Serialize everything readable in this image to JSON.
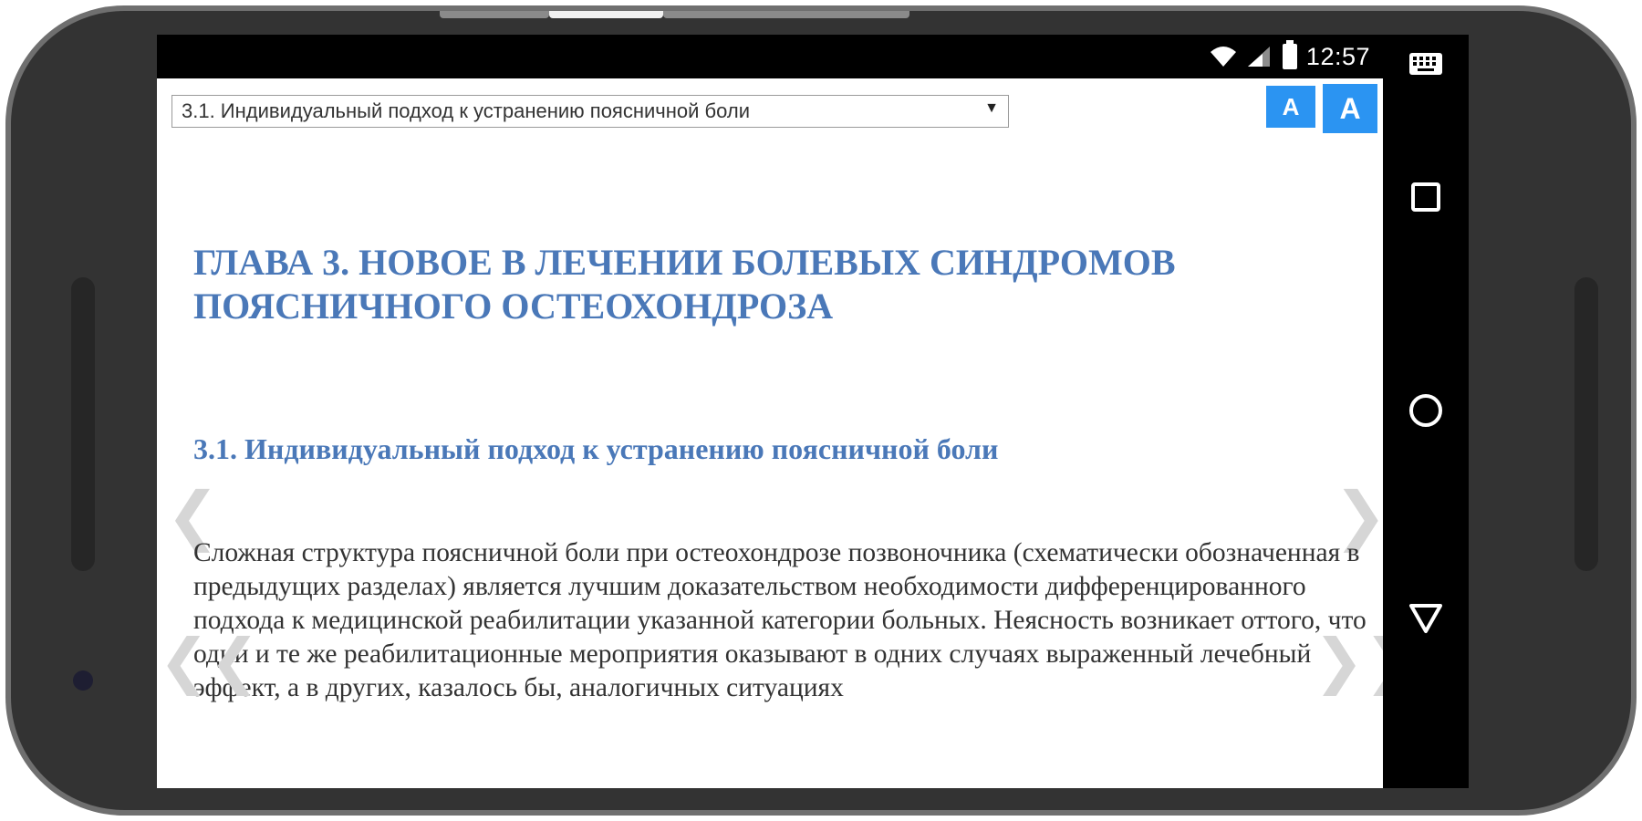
{
  "status_bar": {
    "time": "12:57",
    "icons": [
      "wifi-icon",
      "signal-icon",
      "battery-icon"
    ]
  },
  "nav_bar": {
    "buttons": [
      "keyboard-icon",
      "recent-apps-icon",
      "home-icon",
      "back-icon"
    ]
  },
  "toolbar": {
    "chapter_select_value": "3.1. Индивидуальный подход к устранению поясничной боли",
    "font_small_label": "A",
    "font_large_label": "A"
  },
  "content": {
    "chapter_title": "ГЛАВА 3.  НОВОЕ В ЛЕЧЕНИИ БОЛЕВЫХ СИНДРОМОВ ПОЯСНИЧНОГО ОСТЕОХОНДРОЗА",
    "section_title": "3.1. Индивидуальный подход к устранению поясничной боли",
    "paragraph": "Сложная структура поясничной боли при остеохондрозе позвоночника (схематически обозначенная в предыдущих разделах) является лучшим доказательством необходимости дифференцированного подхода к медицинской реабилитации указанной категории больных. Неясность возникает оттого, что одни и те же реабилитационные мероприятия оказывают в одних случаях выраженный лечебный эффект, а в других, казалось бы, аналогичных ситуациях"
  },
  "page_nav": {
    "prev": "❮",
    "next": "❯",
    "prev_double": "❮❮",
    "next_double": "❯❯"
  },
  "colors": {
    "accent_button": "#2b94f2",
    "heading": "#4a78b8",
    "text": "#333333",
    "device_frame": "#333333"
  }
}
